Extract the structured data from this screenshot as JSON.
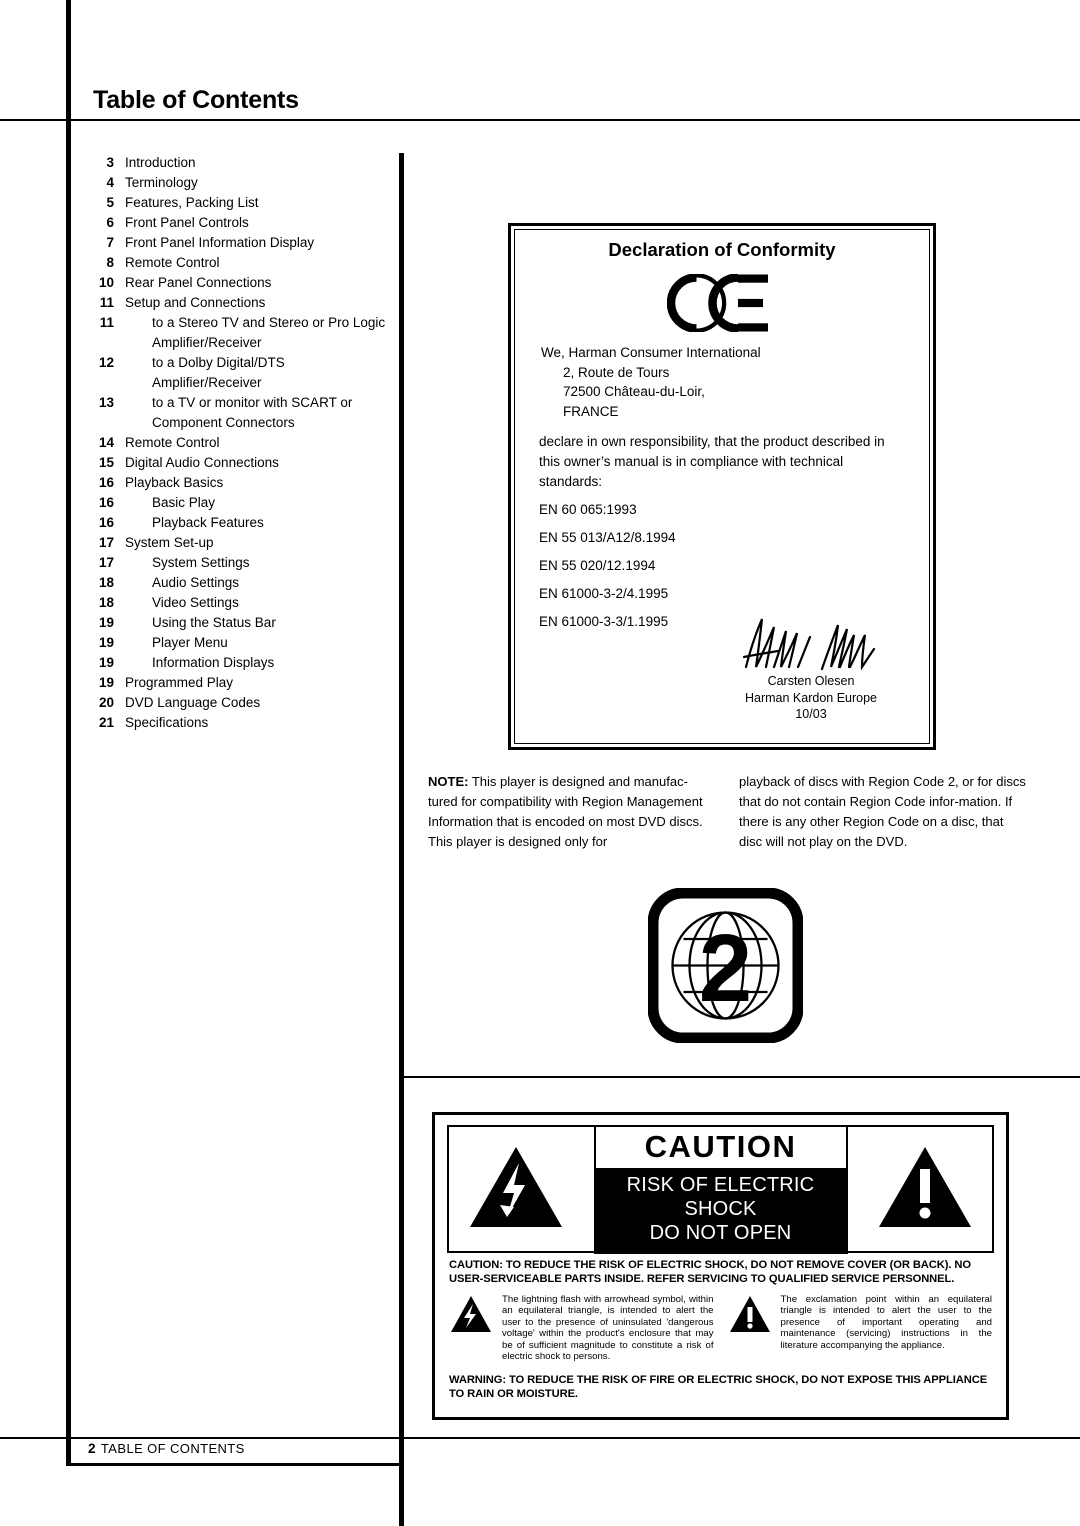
{
  "page": {
    "title": "Table of Contents",
    "footer_page_number": "2",
    "footer_label": "TABLE OF CONTENTS"
  },
  "toc": {
    "entries": [
      {
        "page": "3",
        "label": "Introduction",
        "level": 0
      },
      {
        "page": "4",
        "label": "Terminology",
        "level": 0
      },
      {
        "page": "5",
        "label": "Features, Packing List",
        "level": 0
      },
      {
        "page": "6",
        "label": "Front Panel Controls",
        "level": 0
      },
      {
        "page": "7",
        "label": "Front Panel Information Display",
        "level": 0
      },
      {
        "page": "8",
        "label": "Remote Control",
        "level": 0
      },
      {
        "page": "10",
        "label": "Rear Panel Connections",
        "level": 0
      },
      {
        "page": "11",
        "label": "Setup and Connections",
        "level": 0
      },
      {
        "page": "11",
        "label": "to a Stereo TV and Stereo or Pro Logic",
        "level": 1
      },
      {
        "page": "",
        "label": "Amplifier/Receiver",
        "level": 1,
        "continuation": true
      },
      {
        "page": "12",
        "label": "to a Dolby Digital/DTS Amplifier/Receiver",
        "level": 1
      },
      {
        "page": "13",
        "label": "to a TV or monitor with SCART or",
        "level": 1
      },
      {
        "page": "",
        "label": "Component Connectors",
        "level": 1,
        "continuation": true
      },
      {
        "page": "14",
        "label": "Remote Control",
        "level": 0
      },
      {
        "page": "15",
        "label": "Digital Audio Connections",
        "level": 0
      },
      {
        "page": "16",
        "label": "Playback Basics",
        "level": 0
      },
      {
        "page": "16",
        "label": "Basic Play",
        "level": 1
      },
      {
        "page": "16",
        "label": "Playback Features",
        "level": 1
      },
      {
        "page": "17",
        "label": "System Set-up",
        "level": 0
      },
      {
        "page": "17",
        "label": "System Settings",
        "level": 1
      },
      {
        "page": "18",
        "label": "Audio Settings",
        "level": 1
      },
      {
        "page": "18",
        "label": "Video Settings",
        "level": 1
      },
      {
        "page": "19",
        "label": "Using the Status Bar",
        "level": 1
      },
      {
        "page": "19",
        "label": "Player Menu",
        "level": 1
      },
      {
        "page": "19",
        "label": "Information Displays",
        "level": 1
      },
      {
        "page": "19",
        "label": "Programmed Play",
        "level": 0
      },
      {
        "page": "20",
        "label": "DVD Language Codes",
        "level": 0
      },
      {
        "page": "21",
        "label": "Specifications",
        "level": 0
      }
    ]
  },
  "declaration": {
    "title": "Declaration of Conformity",
    "ce_mark": "ce-mark-icon",
    "company": "We, Harman Consumer International",
    "address_line1": "2, Route de Tours",
    "address_line2": "72500 Château-du-Loir,",
    "address_line3": "FRANCE",
    "statement": "declare in own responsibility, that the product described in this owner’s manual is in compliance with technical standards:",
    "standards": [
      "EN 60 065:1993",
      "EN 55 013/A12/8.1994",
      "EN 55 020/12.1994",
      "EN 61000-3-2/4.1995",
      "EN 61000-3-3/1.1995"
    ],
    "signatory_name": "Carsten Olesen",
    "signatory_org": "Harman Kardon Europe",
    "signatory_date": "10/03"
  },
  "note": {
    "label": "NOTE:",
    "column1": " This player is designed and manufac-tured for compatibility with Region Management Information that is encoded on most DVD discs. This player is designed only for",
    "column2": "playback of discs with Region Code 2, or for discs that do not contain Region Code infor-mation. If there is any other Region Code on a disc, that disc will not play on the DVD."
  },
  "region": {
    "icon_name": "region-code-2-globe-icon",
    "code": "2"
  },
  "caution": {
    "heading": "CAUTION",
    "subheading_line1": "RISK OF ELECTRIC SHOCK",
    "subheading_line2": "DO NOT OPEN",
    "lightning_icon": "lightning-bolt-triangle-icon",
    "exclamation_icon": "exclamation-triangle-icon",
    "main_text": "CAUTION: TO REDUCE THE RISK OF ELECTRIC SHOCK, DO NOT REMOVE COVER (OR BACK). NO USER-SERVICEABLE PARTS INSIDE. REFER SERVICING TO QUALIFIED SERVICE PERSONNEL.",
    "explain_left": "The lightning flash with arrowhead symbol, within an equilateral triangle, is intended to alert the user to the presence of uninsulated 'dangerous voltage' within the product's enclosure that may be of sufficient magnitude to constitute a risk of electric shock to persons.",
    "explain_right": "The exclamation point within an equilateral triangle is intended to alert the user to the presence of important operating and maintenance (servicing) instructions in the literature accompanying the appliance.",
    "warning_text": "WARNING: TO REDUCE THE RISK OF FIRE OR ELECTRIC SHOCK, DO NOT EXPOSE THIS APPLIANCE TO RAIN OR MOISTURE."
  }
}
